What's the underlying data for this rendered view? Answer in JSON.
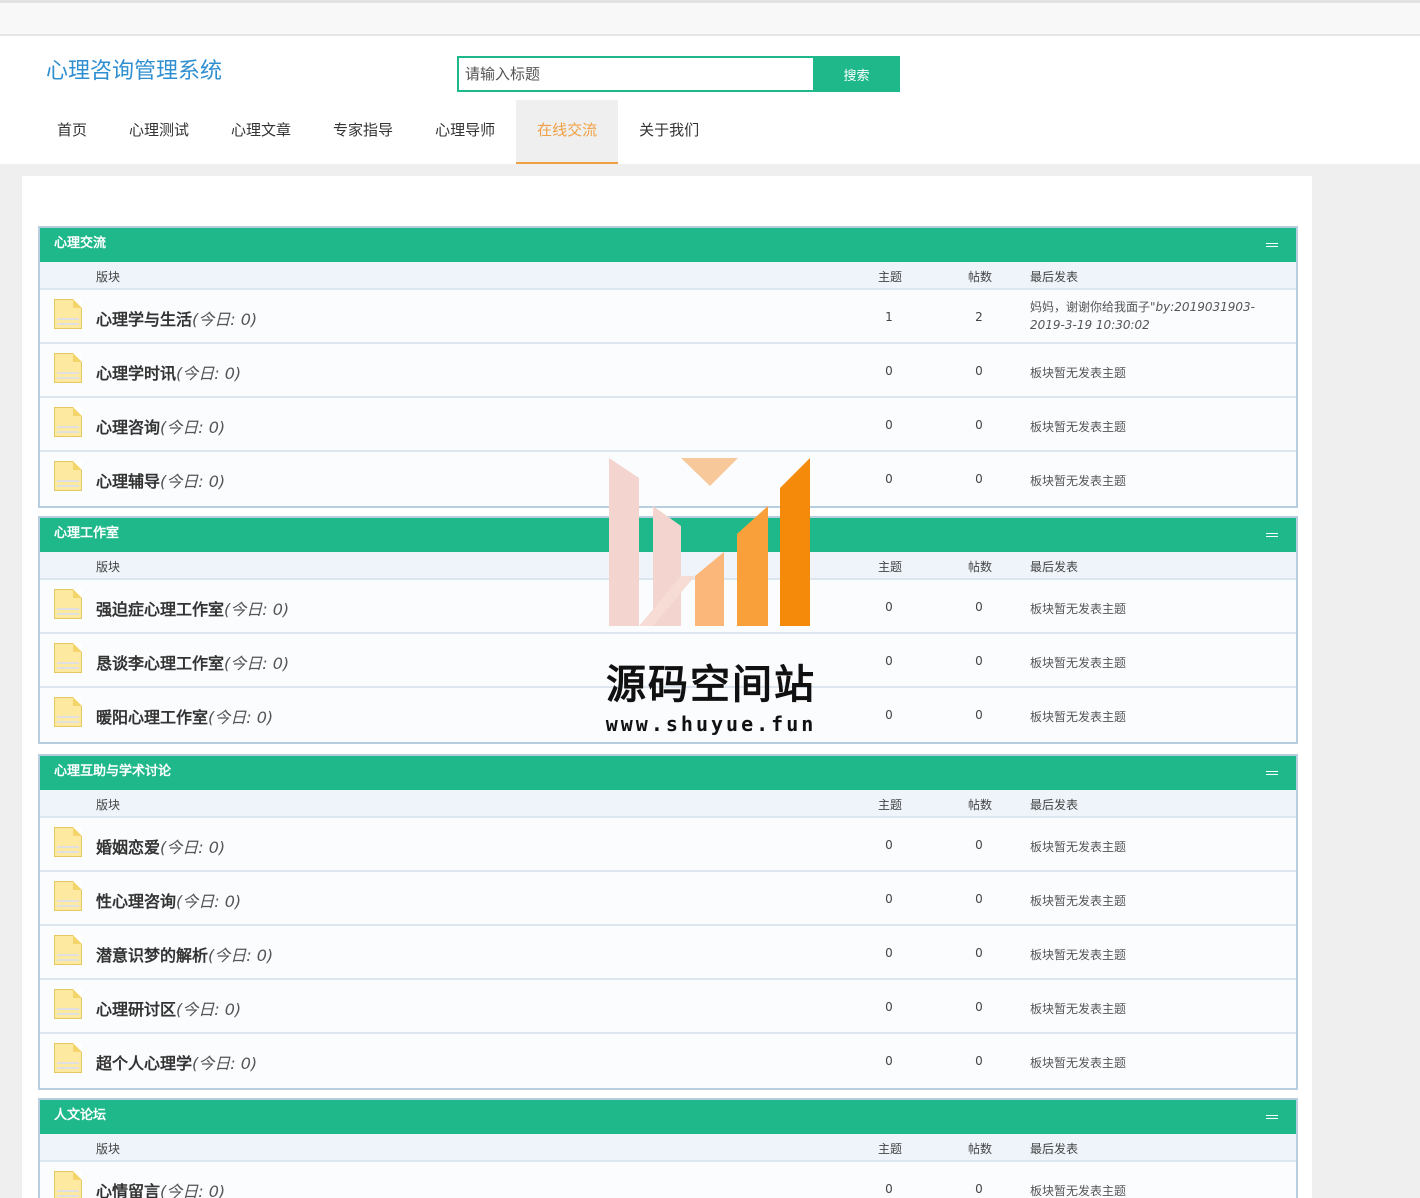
{
  "site": {
    "title": "心理咨询管理系统"
  },
  "search": {
    "placeholder": "请输入标题",
    "button_label": "搜索"
  },
  "nav": [
    {
      "label": "首页",
      "active": false
    },
    {
      "label": "心理测试",
      "active": false
    },
    {
      "label": "心理文章",
      "active": false
    },
    {
      "label": "专家指导",
      "active": false
    },
    {
      "label": "心理导师",
      "active": false
    },
    {
      "label": "在线交流",
      "active": true
    },
    {
      "label": "关于我们",
      "active": false
    }
  ],
  "columns": {
    "board": "版块",
    "topics": "主题",
    "posts": "帖数",
    "last": "最后发表"
  },
  "forums": [
    {
      "title": "心理交流",
      "boards": [
        {
          "name": "心理学与生活",
          "today": "(今日: 0)",
          "topics": "1",
          "posts": "2",
          "last": "妈妈，谢谢你给我面子",
          "last_meta": "\"by:2019031903-2019-3-19 10:30:02"
        },
        {
          "name": "心理学时讯",
          "today": "(今日: 0)",
          "topics": "0",
          "posts": "0",
          "last": "板块暂无发表主题",
          "last_meta": ""
        },
        {
          "name": "心理咨询",
          "today": "(今日: 0)",
          "topics": "0",
          "posts": "0",
          "last": "板块暂无发表主题",
          "last_meta": ""
        },
        {
          "name": "心理辅导",
          "today": "(今日: 0)",
          "topics": "0",
          "posts": "0",
          "last": "板块暂无发表主题",
          "last_meta": ""
        }
      ]
    },
    {
      "title": "心理工作室",
      "boards": [
        {
          "name": "强迫症心理工作室",
          "today": "(今日: 0)",
          "topics": "0",
          "posts": "0",
          "last": "板块暂无发表主题",
          "last_meta": ""
        },
        {
          "name": "恳谈李心理工作室",
          "today": "(今日: 0)",
          "topics": "0",
          "posts": "0",
          "last": "板块暂无发表主题",
          "last_meta": ""
        },
        {
          "name": "暖阳心理工作室",
          "today": "(今日: 0)",
          "topics": "0",
          "posts": "0",
          "last": "板块暂无发表主题",
          "last_meta": ""
        }
      ]
    },
    {
      "title": "心理互助与学术讨论",
      "boards": [
        {
          "name": "婚姻恋爱",
          "today": "(今日: 0)",
          "topics": "0",
          "posts": "0",
          "last": "板块暂无发表主题",
          "last_meta": ""
        },
        {
          "name": "性心理咨询",
          "today": "(今日: 0)",
          "topics": "0",
          "posts": "0",
          "last": "板块暂无发表主题",
          "last_meta": ""
        },
        {
          "name": "潜意识梦的解析",
          "today": "(今日: 0)",
          "topics": "0",
          "posts": "0",
          "last": "板块暂无发表主题",
          "last_meta": ""
        },
        {
          "name": "心理研讨区",
          "today": "(今日: 0)",
          "topics": "0",
          "posts": "0",
          "last": "板块暂无发表主题",
          "last_meta": ""
        },
        {
          "name": "超个人心理学",
          "today": "(今日: 0)",
          "topics": "0",
          "posts": "0",
          "last": "板块暂无发表主题",
          "last_meta": ""
        }
      ]
    },
    {
      "title": "人文论坛",
      "boards": [
        {
          "name": "心情留言",
          "today": "(今日: 0)",
          "topics": "0",
          "posts": "0",
          "last": "板块暂无发表主题",
          "last_meta": ""
        }
      ]
    }
  ],
  "watermark": {
    "name": "源码空间站",
    "url": "www.shuyue.fun"
  },
  "colors": {
    "accent": "#1fb88a",
    "active_nav": "#f0a044",
    "logo": "#2f8fd0"
  }
}
